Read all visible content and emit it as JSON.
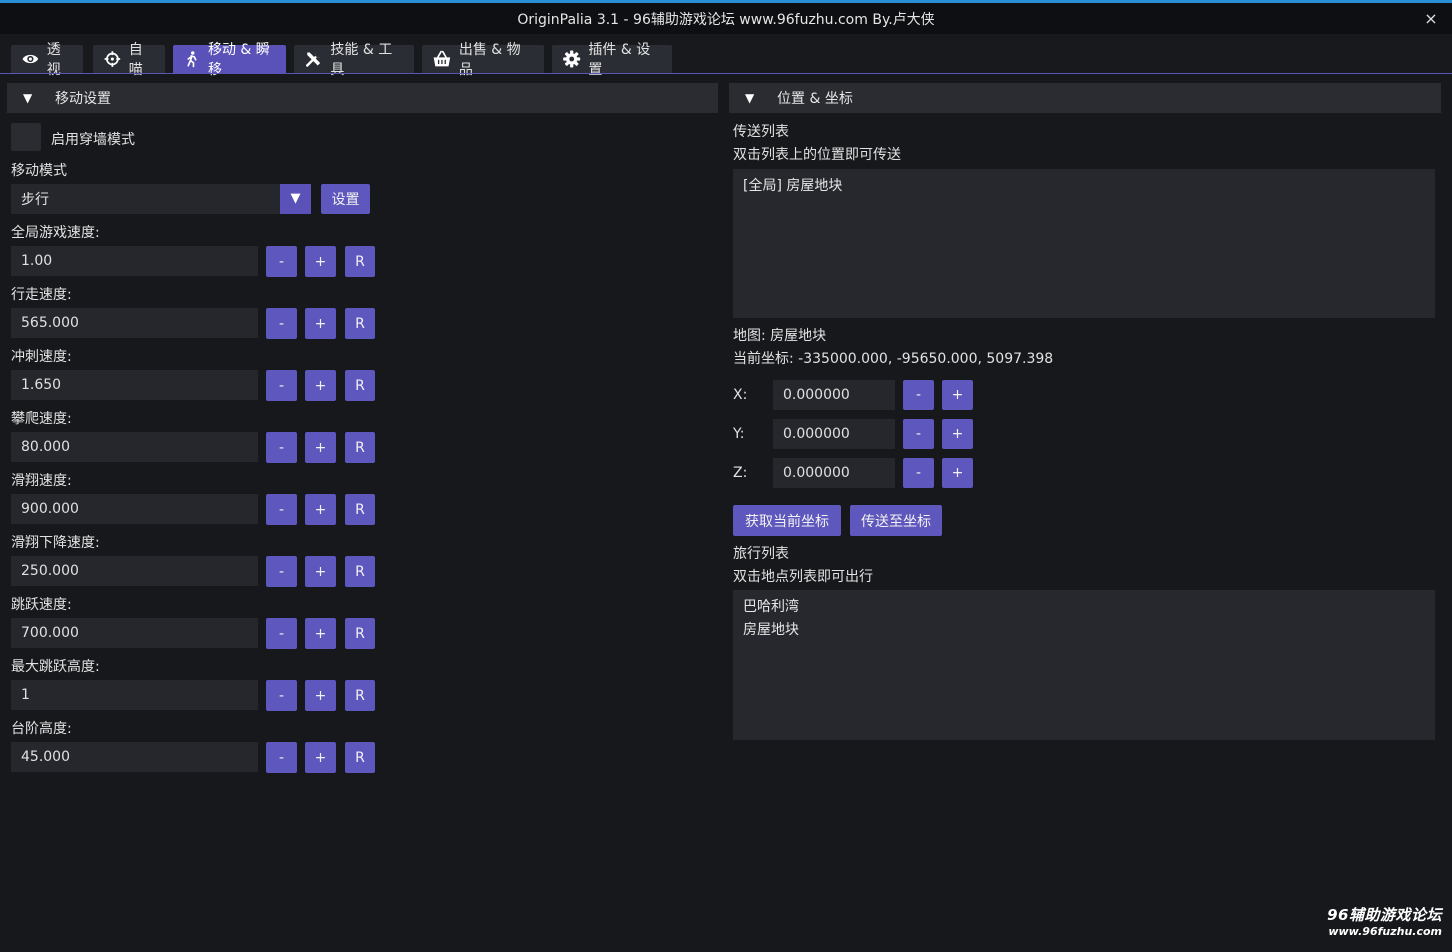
{
  "window": {
    "title": "OriginPalia 3.1 - 96辅助游戏论坛 www.96fuzhu.com By.卢大侠",
    "close_icon": "×"
  },
  "tabs": [
    {
      "label": "透视",
      "icon": "eye-icon"
    },
    {
      "label": "自喵",
      "icon": "crosshair-icon"
    },
    {
      "label": "移动 & 瞬移",
      "icon": "walking-person-icon",
      "active": true
    },
    {
      "label": "技能 & 工具",
      "icon": "tools-icon"
    },
    {
      "label": "出售 & 物品",
      "icon": "basket-icon"
    },
    {
      "label": "插件 & 设置",
      "icon": "gear-icon"
    }
  ],
  "movement": {
    "header": "移动设置",
    "noclip_label": "启用穿墙模式",
    "mode_label": "移动模式",
    "mode_value": "步行",
    "settings_button": "设置",
    "minus": "-",
    "plus": "+",
    "reset": "R",
    "fields": [
      {
        "label": "全局游戏速度:",
        "value": "1.00"
      },
      {
        "label": "行走速度:",
        "value": "565.000"
      },
      {
        "label": "冲刺速度:",
        "value": "1.650"
      },
      {
        "label": "攀爬速度:",
        "value": "80.000"
      },
      {
        "label": "滑翔速度:",
        "value": "900.000"
      },
      {
        "label": "滑翔下降速度:",
        "value": "250.000"
      },
      {
        "label": "跳跃速度:",
        "value": "700.000"
      },
      {
        "label": "最大跳跃高度:",
        "value": "1"
      },
      {
        "label": "台阶高度:",
        "value": "45.000"
      }
    ]
  },
  "position": {
    "header": "位置 & 坐标",
    "teleport_list_title": "传送列表",
    "teleport_list_hint": "双击列表上的位置即可传送",
    "teleport_items": [
      "[全局] 房屋地块"
    ],
    "map_label": "地图: 房屋地块",
    "coords_label": "当前坐标: -335000.000, -95650.000, 5097.398",
    "x_label": "X:",
    "x_value": "0.000000",
    "y_label": "Y:",
    "y_value": "0.000000",
    "z_label": "Z:",
    "z_value": "0.000000",
    "minus": "-",
    "plus": "+",
    "get_coords_button": "获取当前坐标",
    "teleport_button": "传送至坐标",
    "travel_list_title": "旅行列表",
    "travel_list_hint": "双击地点列表即可出行",
    "travel_items": [
      "巴哈利湾",
      "房屋地块"
    ]
  },
  "watermark": {
    "line1": "96辅助游戏论坛",
    "line2": "www.96fuzhu.com"
  }
}
